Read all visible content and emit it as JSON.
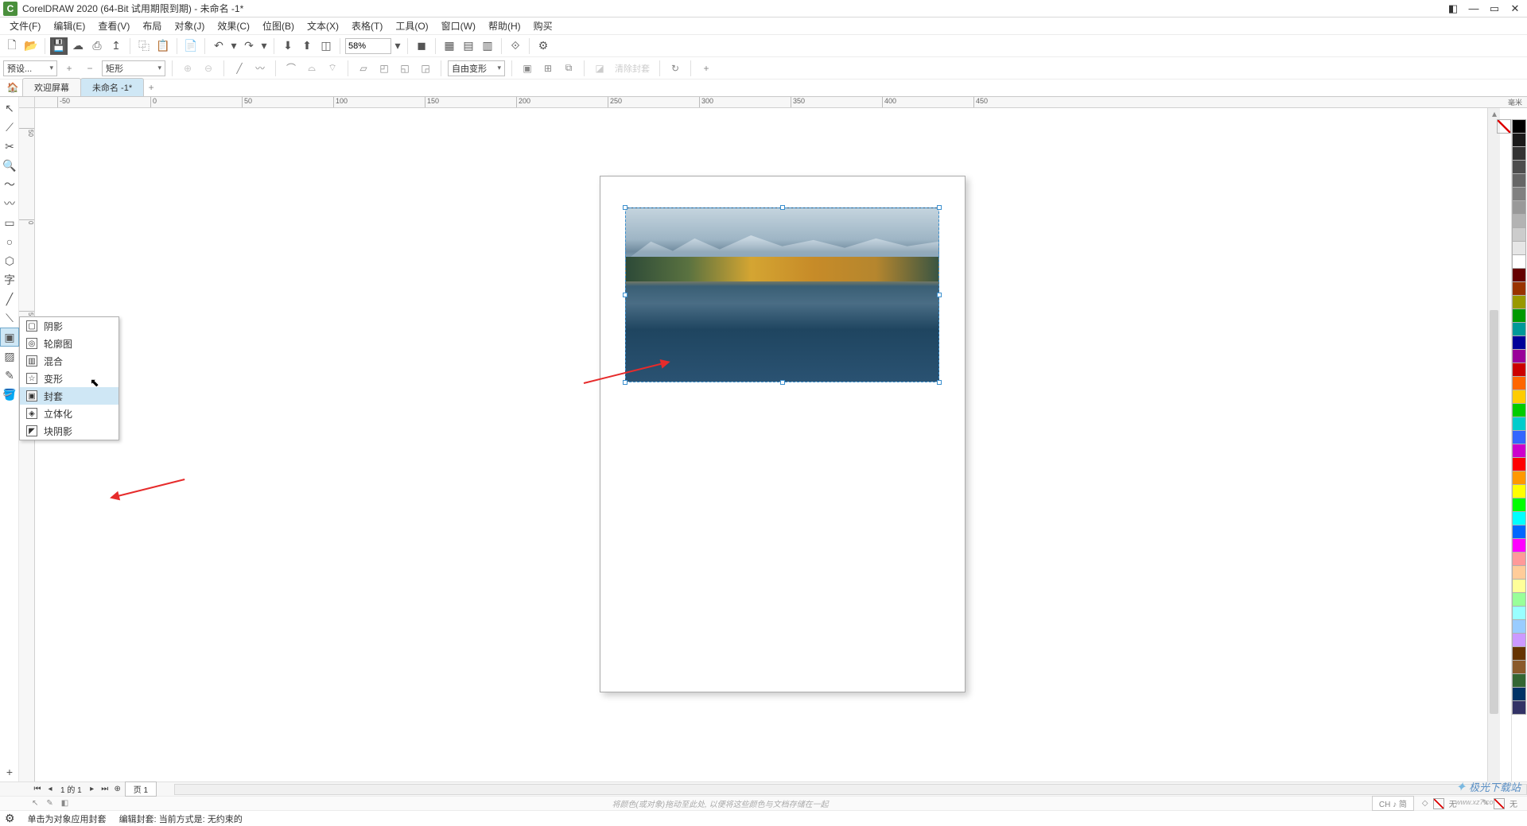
{
  "title": "CorelDRAW 2020 (64-Bit 试用期限到期) - 未命名 -1*",
  "menu": [
    "文件(F)",
    "编辑(E)",
    "查看(V)",
    "布局",
    "对象(J)",
    "效果(C)",
    "位图(B)",
    "文本(X)",
    "表格(T)",
    "工具(O)",
    "窗口(W)",
    "帮助(H)",
    "购买"
  ],
  "zoom": "58%",
  "propbar": {
    "preset": "预设...",
    "shape": "矩形",
    "transform": "自由变形",
    "clear_envelope": "清除封套"
  },
  "tabs": {
    "welcome": "欢迎屏幕",
    "doc": "未命名 -1*"
  },
  "ruler_unit": "毫米",
  "ruler_h_labels": [
    "-50",
    "0",
    "50",
    "100",
    "150",
    "200",
    "250",
    "300",
    "350",
    "400",
    "450"
  ],
  "ruler_v_labels": [
    "50",
    "0"
  ],
  "flyout": {
    "items": [
      {
        "label": "阴影"
      },
      {
        "label": "轮廓图"
      },
      {
        "label": "混合"
      },
      {
        "label": "变形"
      },
      {
        "label": "封套",
        "hl": true
      },
      {
        "label": "立体化"
      },
      {
        "label": "块阴影"
      }
    ]
  },
  "page_nav": {
    "info": "的 1",
    "page_tab": "页 1"
  },
  "status1": {
    "hint": "将颜色(或对象)拖动至此处, 以便将这些颜色与文档存储在一起",
    "ime": "CH ♪ 简",
    "fill_none": "无",
    "outline_none": "无"
  },
  "status2": {
    "hint1": "单击为对象应用封套",
    "hint2": "编辑封套:",
    "hint3": "当前方式是:",
    "hint4": "无约束的"
  },
  "watermark": {
    "main": "极光下载站",
    "sub": "www.xz7.co"
  },
  "palette_colors": [
    "#000000",
    "#1a1a1a",
    "#333333",
    "#4d4d4d",
    "#666666",
    "#808080",
    "#999999",
    "#b3b3b3",
    "#cccccc",
    "#e6e6e6",
    "#ffffff",
    "#660000",
    "#993300",
    "#999900",
    "#009900",
    "#009999",
    "#000099",
    "#990099",
    "#cc0000",
    "#ff6600",
    "#ffcc00",
    "#00cc00",
    "#00cccc",
    "#3366ff",
    "#cc00cc",
    "#ff0000",
    "#ff9900",
    "#ffff00",
    "#00ff00",
    "#00ffff",
    "#0066ff",
    "#ff00ff",
    "#ff9999",
    "#ffcc99",
    "#ffff99",
    "#99ff99",
    "#99ffff",
    "#99ccff",
    "#cc99ff",
    "#663300",
    "#8a5a2b",
    "#336633",
    "#003366",
    "#333366"
  ]
}
